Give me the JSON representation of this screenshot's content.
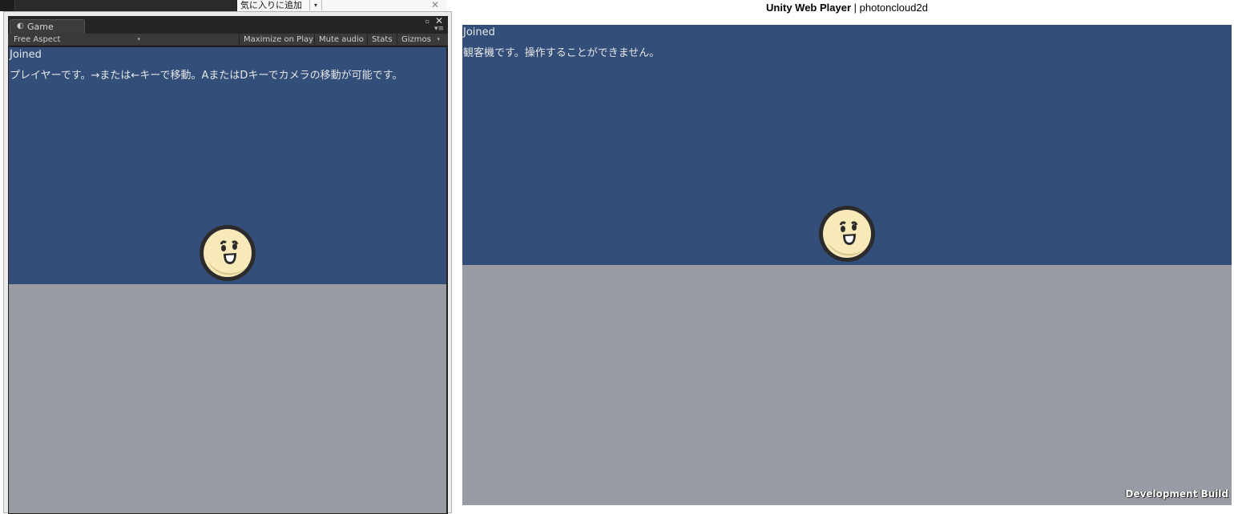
{
  "browser": {
    "favorites_label": "気に入りに追加",
    "dropdown_glyph": "▾",
    "close_glyph": "✕"
  },
  "editor": {
    "tab_label": "Game",
    "toolbar": {
      "aspect": "Free Aspect",
      "maximize": "Maximize on Play",
      "mute": "Mute audio",
      "stats": "Stats",
      "gizmos": "Gizmos"
    },
    "game": {
      "status": "Joined",
      "message": "プレイヤーです。→または←キーで移動。AまたはDキーでカメラの移動が可能です。"
    }
  },
  "webplayer": {
    "title_bold": "Unity Web Player",
    "title_sep": " | ",
    "title_name": "photoncloud2d",
    "game": {
      "status": "Joined",
      "message": "観客機です。操作することができません。"
    },
    "dev_build": "Development Build"
  },
  "colors": {
    "sky": "#324e79",
    "ground": "#989ba3",
    "smiley_face": "#f8eab8",
    "smiley_outline": "#2b2b2b"
  }
}
